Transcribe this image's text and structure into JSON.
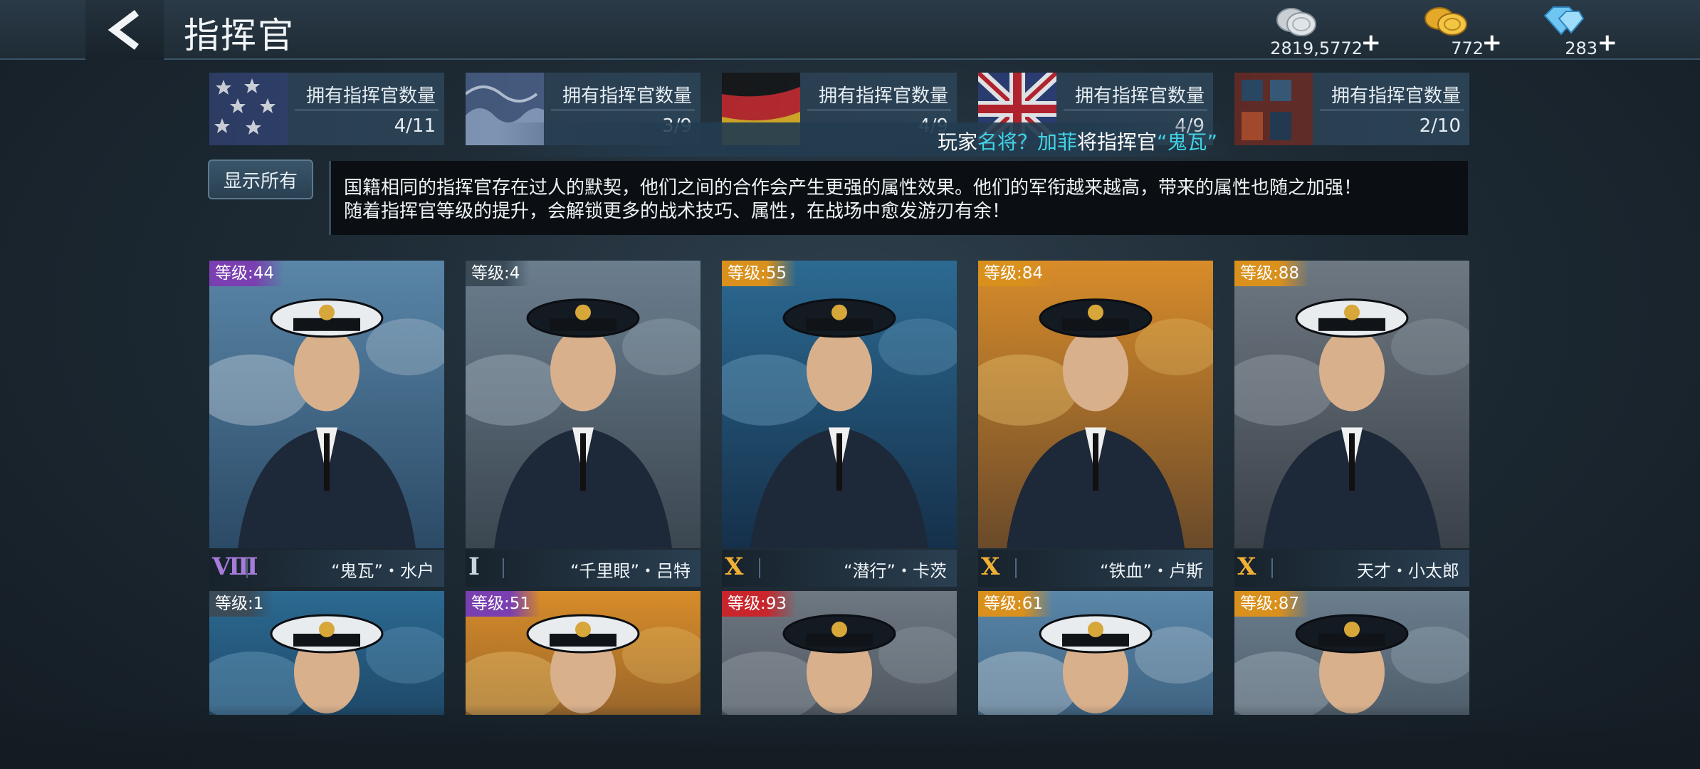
{
  "header": {
    "title": "指挥官",
    "back_icon": "chevron-left-icon",
    "currencies": [
      {
        "name": "silver",
        "icon": "silver-coins-icon",
        "value": "2819,5772"
      },
      {
        "name": "gold",
        "icon": "gold-coins-icon",
        "value": "772"
      },
      {
        "name": "diamond",
        "icon": "diamond-icon",
        "value": "283"
      }
    ],
    "plus": "+"
  },
  "nations": [
    {
      "label": "拥有指挥官数量",
      "count": "4/11",
      "flag": "usa"
    },
    {
      "label": "拥有指挥官数量",
      "count": "3/9",
      "flag": "japan"
    },
    {
      "label": "拥有指挥官数量",
      "count": "4/9",
      "flag": "germany"
    },
    {
      "label": "拥有指挥官数量",
      "count": "4/9",
      "flag": "uk"
    },
    {
      "label": "拥有指挥官数量",
      "count": "2/10",
      "flag": "ussr"
    }
  ],
  "toast": {
    "pre": "玩家",
    "player": "名将？加菲",
    "mid": "将指挥官",
    "commander": "“鬼瓦”"
  },
  "show_all": "显示所有",
  "description": {
    "line1": "国籍相同的指挥官存在过人的默契，他们之间的合作会产生更强的属性效果。他们的军衔越来越高，带来的属性也随之加强！",
    "line2": "随着指挥官等级的提升，会解锁更多的战术技巧、属性，在战场中愈发游刃有余！"
  },
  "cards_row1": [
    {
      "level": "等级:44",
      "rank": "Ⅷ",
      "name": "“鬼瓦”・水户",
      "level_color": "#7a3fb0",
      "rank_color": "#a67bd9"
    },
    {
      "level": "等级:4",
      "rank": "Ⅰ",
      "name": "“千里眼”・吕特",
      "level_color": "#3b4b58",
      "rank_color": "#c9d6e0"
    },
    {
      "level": "等级:55",
      "rank": "Ⅹ",
      "name": "“潜行”・卡茨",
      "level_color": "#d9901c",
      "rank_color": "#f0b036"
    },
    {
      "level": "等级:84",
      "rank": "Ⅹ",
      "name": "“铁血”・卢斯",
      "level_color": "#d9901c",
      "rank_color": "#f0b036"
    },
    {
      "level": "等级:88",
      "rank": "Ⅹ",
      "name": "天才・小太郎",
      "level_color": "#d9901c",
      "rank_color": "#f0b036"
    }
  ],
  "cards_row2": [
    {
      "level": "等级:1",
      "level_color": "#3b4b58"
    },
    {
      "level": "等级:51",
      "level_color": "#7a3fb0"
    },
    {
      "level": "等级:93",
      "level_color": "#c8262c"
    },
    {
      "level": "等级:61",
      "level_color": "#d9901c"
    },
    {
      "level": "等级:87",
      "level_color": "#d9901c"
    }
  ],
  "colors": {
    "accent_cyan": "#3fd4e6",
    "gold": "#f0b036",
    "purple": "#7a3fb0",
    "red": "#c8262c"
  }
}
